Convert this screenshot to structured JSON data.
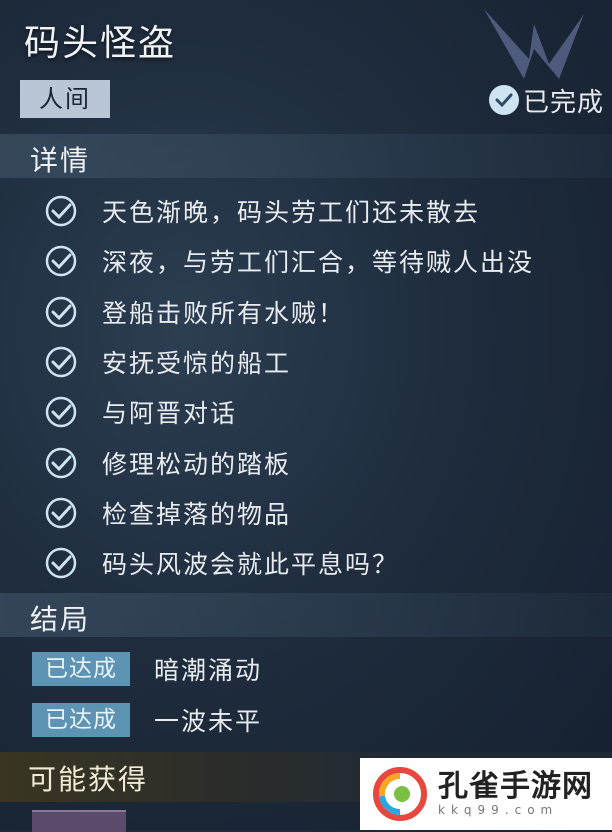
{
  "quest": {
    "title": "码头怪盗",
    "category": "人间",
    "status": "已完成"
  },
  "details": {
    "heading": "详情",
    "steps": [
      "天色渐晚，码头劳工们还未散去",
      "深夜，与劳工们汇合，等待贼人出没",
      "登船击败所有水贼！",
      "安抚受惊的船工",
      "与阿晋对话",
      "修理松动的踏板",
      "检查掉落的物品",
      "码头风波会就此平息吗？"
    ]
  },
  "endings": {
    "heading": "结局",
    "items": [
      {
        "badge": "已达成",
        "name": "暗潮涌动"
      },
      {
        "badge": "已达成",
        "name": "一波未平"
      }
    ]
  },
  "rewards": {
    "heading": "可能获得"
  },
  "watermark": {
    "name": "孔雀手游网",
    "domain": "kkq99.com"
  },
  "colors": {
    "check": "#cfe4f2",
    "badge": "#5d94b3",
    "tag": "#b9c6d6"
  },
  "icons": {
    "status": "check-circle-icon",
    "step": "check-circle-icon",
    "emblem": "guild-emblem-icon",
    "watermark_logo": "peacock-logo-icon"
  }
}
